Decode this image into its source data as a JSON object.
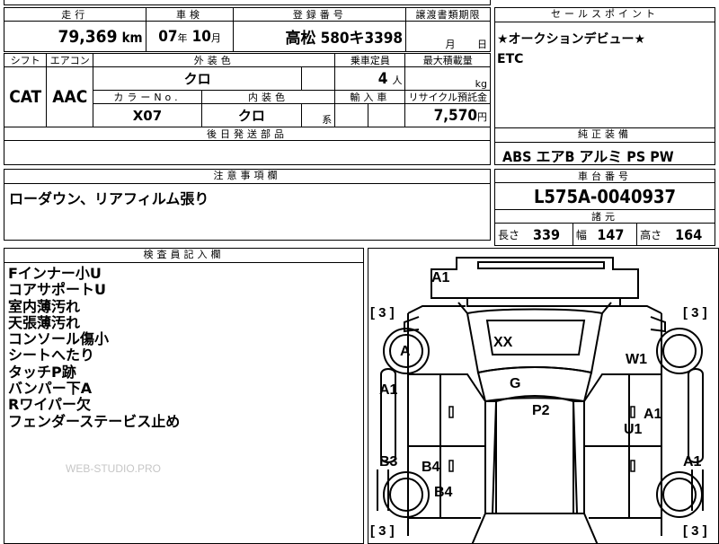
{
  "vehicle": {
    "mileage": "79,369",
    "mileage_unit": "km",
    "year": "07",
    "year_unit": "年",
    "month": "10",
    "month_unit": "月",
    "reg_place": "高松",
    "reg_number": "580キ3398",
    "transfer_month": "月",
    "transfer_day": "日",
    "shift": "CAT",
    "aircon": "AAC",
    "exterior_color": "クロ",
    "color_no": "X07",
    "interior_color": "クロ",
    "interior_suffix": "系",
    "capacity": "4",
    "capacity_unit": "人",
    "load_unit": "kg",
    "recycle_fee": "7,570",
    "recycle_unit": "円"
  },
  "headers": {
    "mileage": "走行",
    "inspection": "車検",
    "registration": "登録番号",
    "transfer": "譲渡書類期限",
    "sales_point": "セールスポイント",
    "shift": "シフト",
    "aircon": "エアコン",
    "exterior": "外装色",
    "capacity": "乗車定員",
    "max_load": "最大積載量",
    "color_no": "カラーNo.",
    "interior": "内装色",
    "import": "輸入車",
    "recycle": "リサイクル預託金",
    "later_parts": "後日発送部品",
    "equipment": "純正装備",
    "notes": "注意事項欄",
    "chassis": "車台番号",
    "specs": "諸元",
    "inspector": "検査員記入欄"
  },
  "sales_points": [
    "★オークションデビュー★",
    "ETC"
  ],
  "equipment": "ABS エアB アルミ PS PW",
  "notes_text": "ローダウン、リアフィルム張り",
  "chassis_number": "L575A-0040937",
  "specs": {
    "length_label": "長さ",
    "length": "339",
    "width_label": "幅",
    "width": "147",
    "height_label": "高さ",
    "height": "164"
  },
  "inspector_notes": [
    "Fインナー小U",
    "コアサポートU",
    "室内薄汚れ",
    "天張薄汚れ",
    "コンソール傷小",
    "シートへたり",
    "タッチP跡",
    "バンパー下A",
    "Rワイパー欠",
    "フェンダーステービス止め"
  ],
  "watermark": "WEB-STUDIO.PRO",
  "diagram": {
    "tires": [
      "[ 3 ]",
      "[ 3 ]",
      "[ 3 ]",
      "[ 3 ]"
    ],
    "marks": {
      "front_bumper": "A1",
      "front_left_tire": "A",
      "hood": "XX",
      "front_right_fender": "W1",
      "left_front_door": "A1",
      "roof_front": "G",
      "roof": "P2",
      "right_door": "A1",
      "right_door2": "U1",
      "left_rear_quarter": "B3",
      "left_rear_door": "B4",
      "rear_left_tire": "B4",
      "right_rear_quarter": "A1"
    }
  }
}
